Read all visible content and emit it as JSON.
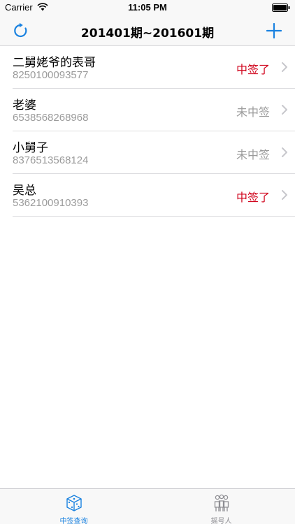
{
  "status_bar": {
    "carrier": "Carrier",
    "time": "11:05 PM"
  },
  "nav": {
    "title": "201401期~201601期",
    "left_icon": "refresh-icon",
    "right_icon": "plus-icon"
  },
  "rows": [
    {
      "name": "二舅姥爷的表哥",
      "number": "8250100093577",
      "status": "中签了",
      "won": true
    },
    {
      "name": "老婆",
      "number": "6538568268968",
      "status": "未中签",
      "won": false
    },
    {
      "name": "小舅子",
      "number": "8376513568124",
      "status": "未中签",
      "won": false
    },
    {
      "name": "吴总",
      "number": "5362100910393",
      "status": "中签了",
      "won": true
    }
  ],
  "tabs": [
    {
      "label": "中签查询",
      "icon": "dice-icon",
      "active": true
    },
    {
      "label": "摇号人",
      "icon": "people-icon",
      "active": false
    }
  ],
  "colors": {
    "accent": "#1a82e0",
    "won": "#d0021b",
    "lost": "#9b9b9b",
    "bar_background": "#f8f8f8"
  }
}
